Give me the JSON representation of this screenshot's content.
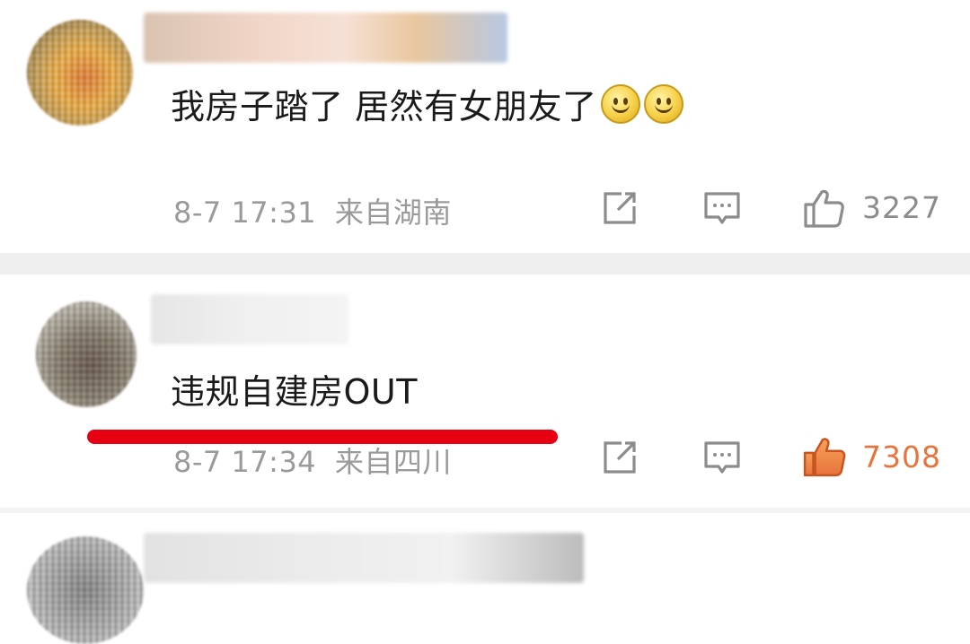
{
  "comments": [
    {
      "text": "我房子踏了 居然有女朋友了",
      "emoji": "smile-emoji",
      "time": "8-7 17:31",
      "location": "来自湖南",
      "likes": "3227",
      "liked": false
    },
    {
      "text": "违规自建房OUT",
      "time": "8-7 17:34",
      "location": "来自四川",
      "likes": "7308",
      "liked": true
    }
  ],
  "colors": {
    "like_active": "#e8743c",
    "annotation_line": "#e60012",
    "meta_text": "#9a9a9a"
  },
  "icons": [
    "share-icon",
    "comment-icon",
    "thumbs-up-icon"
  ]
}
